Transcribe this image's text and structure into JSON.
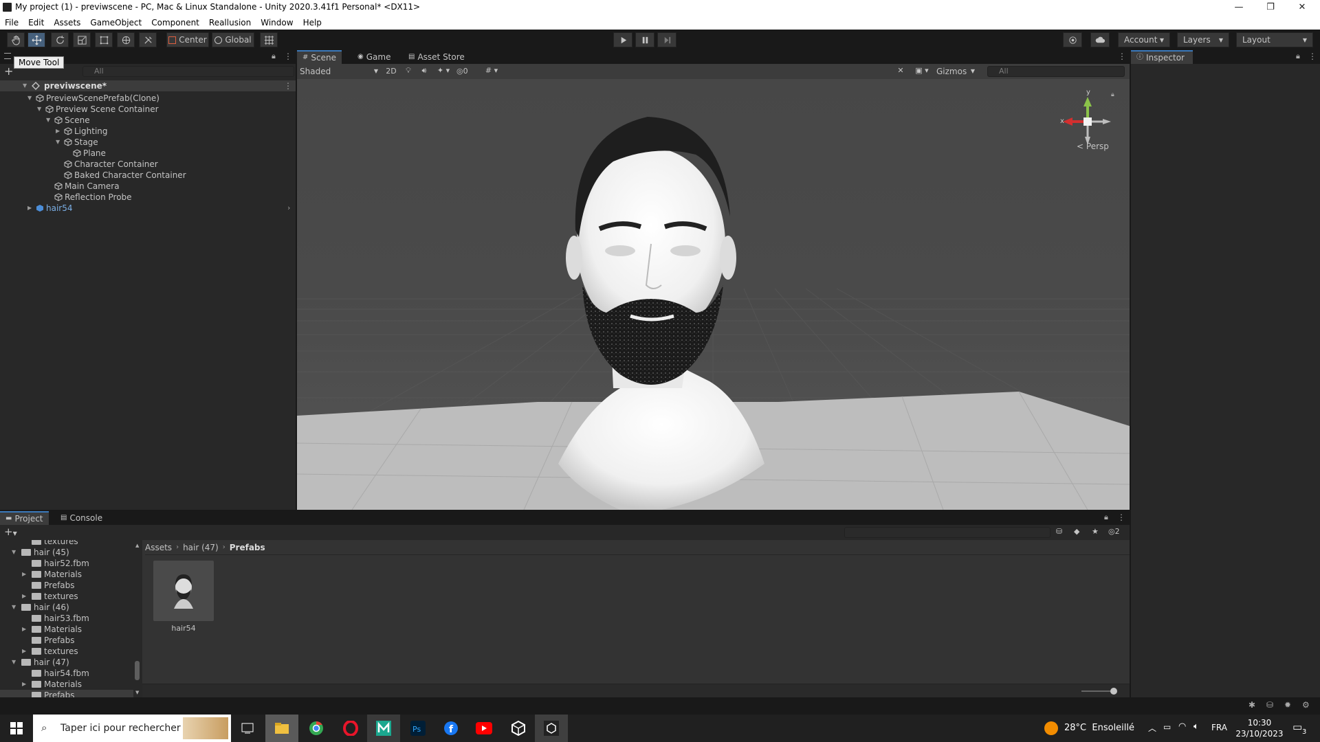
{
  "window": {
    "title": "My project (1) - previwscene - PC, Mac & Linux Standalone - Unity 2020.3.41f1 Personal* <DX11>",
    "minimize": "—",
    "maximize": "❐",
    "close": "✕"
  },
  "menu": [
    "File",
    "Edit",
    "Assets",
    "GameObject",
    "Component",
    "Reallusion",
    "Window",
    "Help"
  ],
  "toolbar": {
    "pivot": "Center",
    "space": "Global",
    "account": "Account",
    "layers": "Layers",
    "layout": "Layout",
    "tooltip": "Move Tool"
  },
  "hierarchy": {
    "search_placeholder": "All",
    "scene_name": "previwscene*",
    "items": [
      {
        "label": "PreviewScenePrefab(Clone)"
      },
      {
        "label": "Preview Scene Container"
      },
      {
        "label": "Scene"
      },
      {
        "label": "Lighting"
      },
      {
        "label": "Stage"
      },
      {
        "label": "Plane"
      },
      {
        "label": "Character Container"
      },
      {
        "label": "Baked Character Container"
      },
      {
        "label": "Main Camera"
      },
      {
        "label": "Reflection Probe"
      },
      {
        "label": "hair54"
      }
    ]
  },
  "scene": {
    "tabs": [
      "Scene",
      "Game",
      "Asset Store"
    ],
    "shading": "Shaded",
    "mode2d": "2D",
    "hidden_count": "0",
    "gizmos": "Gizmos",
    "search_placeholder": "All",
    "persp": "Persp",
    "axis_y": "y",
    "axis_x": "x"
  },
  "inspector": {
    "tab": "Inspector"
  },
  "project": {
    "tabs": [
      "Project",
      "Console"
    ],
    "tree": [
      {
        "label": "textures"
      },
      {
        "label": "hair (45)"
      },
      {
        "label": "hair52.fbm"
      },
      {
        "label": "Materials"
      },
      {
        "label": "Prefabs"
      },
      {
        "label": "textures"
      },
      {
        "label": "hair (46)"
      },
      {
        "label": "hair53.fbm"
      },
      {
        "label": "Materials"
      },
      {
        "label": "Prefabs"
      },
      {
        "label": "textures"
      },
      {
        "label": "hair (47)"
      },
      {
        "label": "hair54.fbm"
      },
      {
        "label": "Materials"
      },
      {
        "label": "Prefabs"
      }
    ],
    "breadcrumb": [
      "Assets",
      "hair (47)",
      "Prefabs"
    ],
    "asset_name": "hair54",
    "hidden_count": "2"
  },
  "taskbar": {
    "search_placeholder": "Taper ici pour rechercher",
    "weather": "28°C  Ensoleillé",
    "lang": "FRA",
    "time": "10:30",
    "date": "23/10/2023",
    "notif": "3"
  },
  "colors": {
    "accent": "#3a79bb",
    "selection": "#2c5d87",
    "panel": "#282828",
    "toolbar_active": "#46607c"
  }
}
